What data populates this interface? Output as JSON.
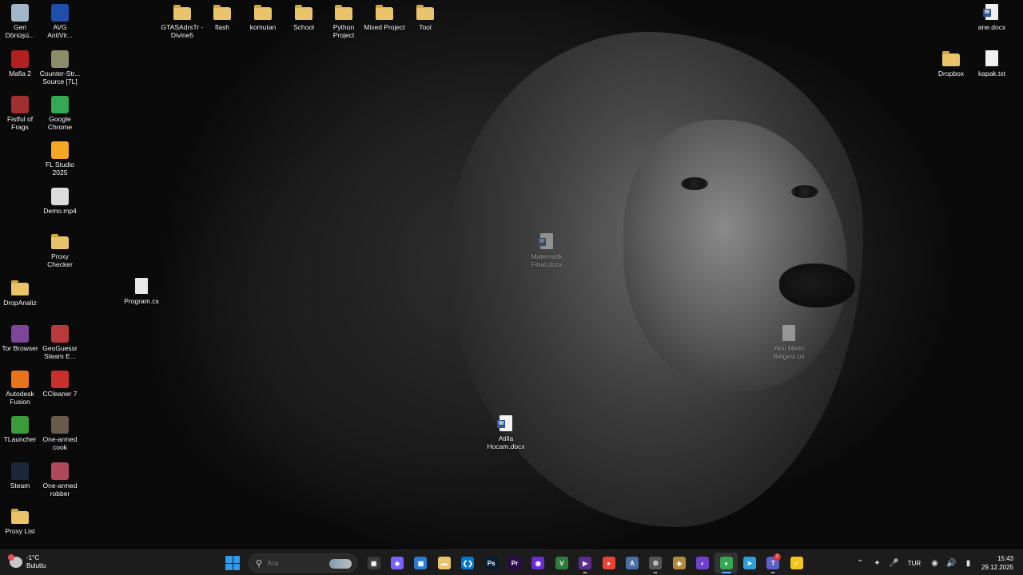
{
  "desktop": {
    "icons_left": [
      {
        "label": "Geri\nDönüşü...",
        "icon": "recycle-bin-icon",
        "color": "#9fb7c9"
      },
      {
        "label": "AVG\nAntiVir...",
        "icon": "avg-antivirus-icon",
        "color": "#1f4fa8"
      },
      {
        "label": "Mafia 2",
        "icon": "mafia-2-icon",
        "color": "#b32020"
      },
      {
        "label": "Counter-Str...\nSource [7L]",
        "icon": "counter-strike-icon",
        "color": "#8c8c6a"
      },
      {
        "label": "Fistful of\nFrags",
        "icon": "fistful-of-frags-icon",
        "color": "#a03030"
      },
      {
        "label": "Google\nChrome",
        "icon": "chrome-icon",
        "color": "#34a853"
      },
      {
        "label": "FL Studio\n2025",
        "icon": "fl-studio-icon",
        "color": "#f5a623"
      },
      {
        "label": "Demo.mp4",
        "icon": "video-file-icon",
        "color": "#dcdcdc"
      },
      {
        "label": "Proxy\nChecker",
        "icon": "folder-icon",
        "color": "#e9c46a"
      },
      {
        "label": "DropAnaliz",
        "icon": "folder-icon",
        "color": "#e9c46a"
      },
      {
        "label": "Tor Browser",
        "icon": "tor-browser-icon",
        "color": "#7d4698"
      },
      {
        "label": "GeoGuessr\nSteam E...",
        "icon": "geoguessr-icon",
        "color": "#b83a3a"
      },
      {
        "label": "Autodesk\nFusion",
        "icon": "autodesk-fusion-icon",
        "color": "#e8731a"
      },
      {
        "label": "CCleaner 7",
        "icon": "ccleaner-icon",
        "color": "#c9302c"
      },
      {
        "label": "TLauncher",
        "icon": "tlauncher-icon",
        "color": "#3a9b3a"
      },
      {
        "label": "One-armed\ncook",
        "icon": "one-armed-cook-icon",
        "color": "#6a5a4a"
      },
      {
        "label": "Steam",
        "icon": "steam-icon",
        "color": "#1b2838"
      },
      {
        "label": "One-armed\nrobber",
        "icon": "one-armed-robber-icon",
        "color": "#b04a5a"
      },
      {
        "label": "Proxy List",
        "icon": "folder-icon",
        "color": "#e9c46a"
      }
    ],
    "icons_top": [
      {
        "label": "GTASAdrsTr -\nDivine5"
      },
      {
        "label": "flash"
      },
      {
        "label": "komutan"
      },
      {
        "label": "School"
      },
      {
        "label": "Python\nProject"
      },
      {
        "label": "Mixed Project"
      },
      {
        "label": "Tool"
      }
    ],
    "icons_right": [
      {
        "label": "ane.docx"
      },
      {
        "label": "Dropbox"
      },
      {
        "label": "kapak.txt"
      }
    ],
    "icons_scattered": [
      {
        "label": "Program.cs"
      },
      {
        "label": "Matematik\nFinal.docx"
      },
      {
        "label": "Yeni Metin\nBelgesi.txt"
      },
      {
        "label": "Atilla\nHocam.docx"
      }
    ]
  },
  "taskbar": {
    "weather": {
      "temp": "-1°C",
      "condition": "Bulutlu"
    },
    "search_placeholder": "Ara",
    "apps": [
      {
        "name": "task-view",
        "glyph": "▣",
        "color": "#3a3a3a",
        "running": false
      },
      {
        "name": "copilot",
        "glyph": "◆",
        "color": "#7b61ff",
        "running": false
      },
      {
        "name": "microsoft-store",
        "glyph": "▦",
        "color": "#2b7cd3",
        "running": false
      },
      {
        "name": "file-explorer",
        "glyph": "▬",
        "color": "#e9c46a",
        "running": false
      },
      {
        "name": "vscode",
        "glyph": "❮❯",
        "color": "#0078d4",
        "running": false
      },
      {
        "name": "photoshop",
        "glyph": "Ps",
        "color": "#001e36",
        "running": false
      },
      {
        "name": "premiere",
        "glyph": "Pr",
        "color": "#2a0a4a",
        "running": false
      },
      {
        "name": "obs",
        "glyph": "◉",
        "color": "#6b2fd1",
        "running": false
      },
      {
        "name": "visual-studio-installer",
        "glyph": "V",
        "color": "#2f7d3a",
        "running": false
      },
      {
        "name": "visual-studio",
        "glyph": "▶",
        "color": "#5c2d91",
        "running": true
      },
      {
        "name": "chrome",
        "glyph": "●",
        "color": "#ea4335",
        "running": false
      },
      {
        "name": "app-store-like",
        "glyph": "A",
        "color": "#4a6fa5",
        "running": false
      },
      {
        "name": "app-badged",
        "glyph": "⚙",
        "color": "#555555",
        "running": true
      },
      {
        "name": "app-shield",
        "glyph": "◈",
        "color": "#b08a3a",
        "running": false
      },
      {
        "name": "github-desktop",
        "glyph": "◐",
        "color": "#6e40c9",
        "running": false
      },
      {
        "name": "chrome-active",
        "glyph": "●",
        "color": "#34a853",
        "running": true
      },
      {
        "name": "telegram",
        "glyph": "➤",
        "color": "#2aa1da",
        "running": false
      },
      {
        "name": "teams",
        "glyph": "T",
        "color": "#5b5fc7",
        "running": true
      },
      {
        "name": "norton",
        "glyph": "✓",
        "color": "#f5c518",
        "running": false
      }
    ],
    "badge_count": "2",
    "language": "TUR",
    "time": "15:43",
    "date": "29.12.2025"
  }
}
